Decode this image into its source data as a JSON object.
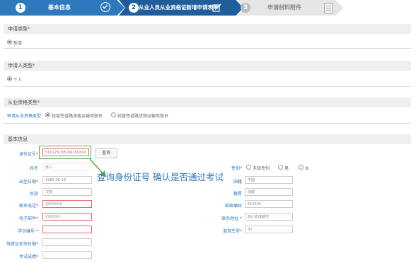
{
  "steps": [
    {
      "num": "1",
      "label": "基本信息"
    },
    {
      "num": "2",
      "label": "从业人员从业资格证新增申请表单"
    },
    {
      "num": "3",
      "label": "申请材料附件"
    }
  ],
  "sections": {
    "apply_type": {
      "title": "申请类型",
      "option": "新增"
    },
    "applicant_type": {
      "title": "申请人类型",
      "option": "个人"
    },
    "qual_type": {
      "title": "从业资格类型",
      "field_label": "申请从业资格类型",
      "opt1": "经营性道路旅客运输驾驶员",
      "opt2": "经营性道路货物运输驾驶员"
    },
    "basic": {
      "title": "基本信息"
    }
  },
  "form": {
    "id_label": "身份证号",
    "id_value": "510125198206180XXX",
    "query_button": "查询",
    "name_label": "姓名",
    "name_value": "张三",
    "gender_label": "性别",
    "gender_opt1": "未知性别",
    "gender_opt2": "男",
    "gender_opt3": "女",
    "birth_label": "出生日期",
    "birth_value": "1982-06-18",
    "nation_label": "国籍",
    "nation_value": "中国",
    "ethnic_label": "民族",
    "ethnic_value": "汉族",
    "origin_label": "籍贯",
    "origin_value": "成都",
    "phone_label": "联系电话",
    "phone_value": "1XXXXXX",
    "postcode_label": "邮政编码",
    "postcode_value": "610500",
    "email_label": "电子邮件",
    "email_value": "XXXXXX",
    "address_label": "联系地址",
    "address_value": "四川省成都市",
    "student_no_label": "学员编号",
    "vehicle_label": "准驾车型",
    "vehicle_value": "B2",
    "license_date_label": "驾驶证初领日期",
    "score_label": "考试成绩"
  },
  "annotation": "查询身份证号 确认是否通过考试"
}
